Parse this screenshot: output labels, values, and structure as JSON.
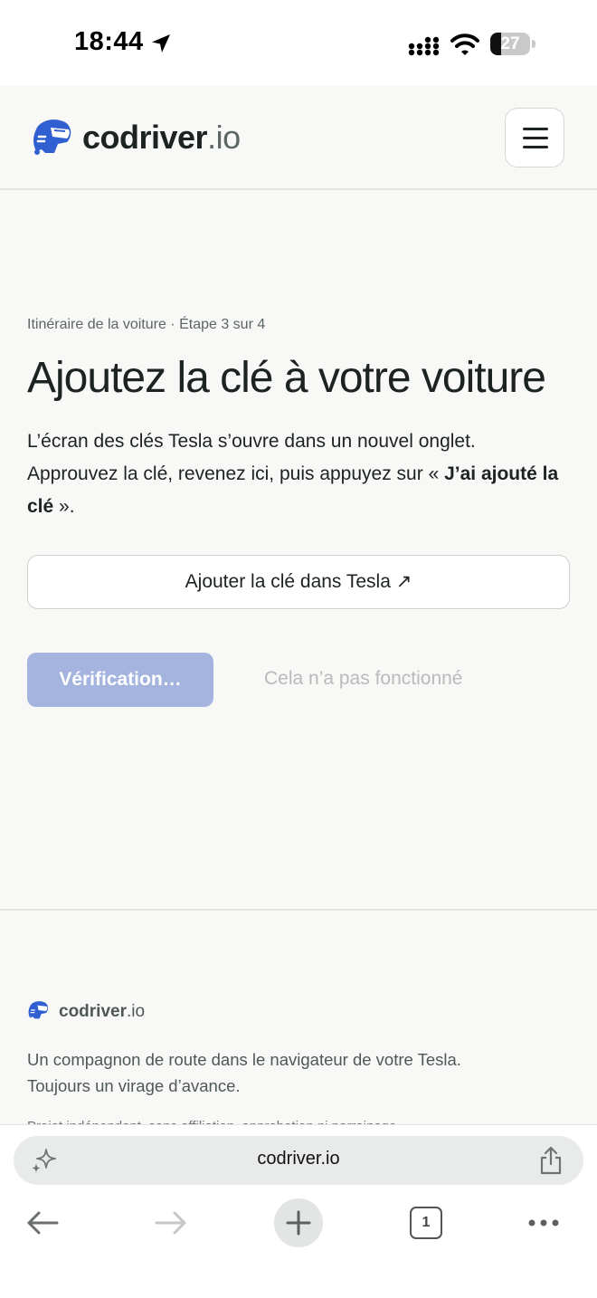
{
  "status_bar": {
    "time": "18:44",
    "battery": "27"
  },
  "header": {
    "brand_name": "codriver",
    "brand_tld": ".io",
    "menu_icon": "hamburger-menu-icon",
    "logo_icon": "helmet-logo-icon"
  },
  "main": {
    "breadcrumb": "Itinéraire de la voiture · Étape 3 sur 4",
    "title": "Ajoutez la clé à votre voiture",
    "description_part1": "L’écran des clés Tesla s’ouvre dans un nouvel onglet. Approuvez la clé, revenez ici, puis appuyez sur « ",
    "description_bold": "J’ai ajouté la clé",
    "description_part2": " ».",
    "add_key_button": "Ajouter la clé dans Tesla ↗",
    "verify_button": "Vérification…",
    "failed_link": "Cela n’a pas fonctionné"
  },
  "footer": {
    "brand_name": "codriver",
    "brand_tld": ".io",
    "tagline": "Un compagnon de route dans le navigateur de votre Tesla. Toujours un virage d’avance.",
    "disclaimer": "Projet indépendant, sans affiliation, approbation ni parrainage"
  },
  "browser": {
    "url": "codriver.io",
    "tab_count": "1"
  },
  "colors": {
    "accent": "#2f5fd0",
    "verify_button_bg": "#a4b4df",
    "page_bg": "#f8f8f6",
    "text": "#1c2321"
  }
}
